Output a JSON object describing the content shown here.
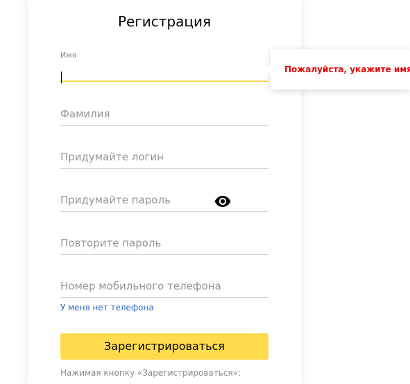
{
  "form": {
    "title": "Регистрация",
    "first_name": {
      "label": "Имя",
      "value": ""
    },
    "last_name": {
      "placeholder": "Фамилия"
    },
    "login": {
      "placeholder": "Придумайте логин"
    },
    "password": {
      "placeholder": "Придумайте пароль",
      "toggle_icon": "eye-icon"
    },
    "password_repeat": {
      "placeholder": "Повторите пароль"
    },
    "phone": {
      "placeholder": "Номер мобильного телефона"
    },
    "no_phone_link": "У меня нет телефона",
    "submit_label": "Зарегистрироваться",
    "footnote": "Нажимая кнопку «Зарегистрироваться»:"
  },
  "tooltip": {
    "message": "Пожалуйста, укажите имя"
  },
  "colors": {
    "accent_yellow": "#ffdb4d",
    "active_underline": "#f7d64a",
    "error_red": "#e60000",
    "link_blue": "#2f68bf"
  }
}
